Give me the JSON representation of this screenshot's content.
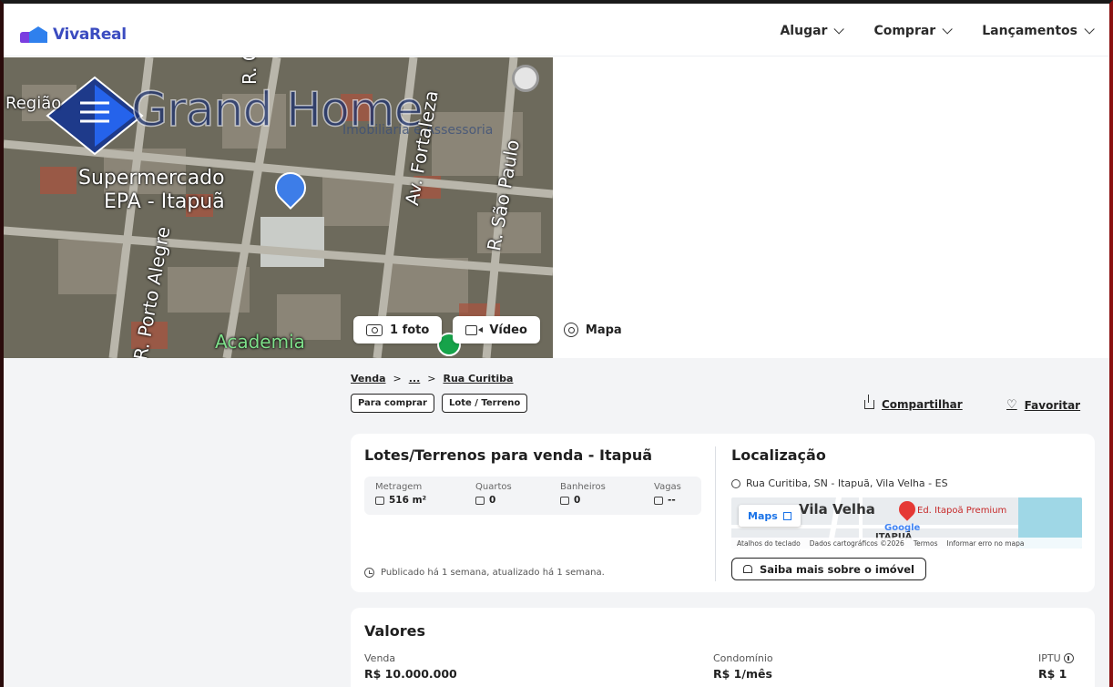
{
  "header": {
    "logo_text": "VivaReal",
    "nav": [
      {
        "label": "Alugar"
      },
      {
        "label": "Comprar"
      },
      {
        "label": "Lançamentos"
      }
    ]
  },
  "photo": {
    "watermark_brand": "Grand Home",
    "watermark_sub": "Imobiliária e Assessoria",
    "map_labels": [
      "Supermercado",
      "EPA - Itapuã",
      "R. Curitiba",
      "Av. Fortaleza",
      "R. São Paulo",
      "R. Porto Alegre",
      "Academia",
      "Região"
    ]
  },
  "media_buttons": {
    "photo_label": "1 foto",
    "video_label": "Vídeo",
    "map_label": "Mapa"
  },
  "breadcrumb": {
    "first": "Venda",
    "middle": "...",
    "last": "Rua Curitiba",
    "separator": ">"
  },
  "tags": [
    "Para comprar",
    "Lote / Terreno"
  ],
  "actions": {
    "share": "Compartilhar",
    "favorite": "Favoritar"
  },
  "listing": {
    "title": "Lotes/Terrenos para venda - Itapuã",
    "stats": [
      {
        "label": "Metragem",
        "value": "516 m²",
        "icon": "ruler-icon"
      },
      {
        "label": "Quartos",
        "value": "0",
        "icon": "bed-icon"
      },
      {
        "label": "Banheiros",
        "value": "0",
        "icon": "shower-icon"
      },
      {
        "label": "Vagas",
        "value": "--",
        "icon": "car-icon"
      }
    ],
    "published": "Publicado há 1 semana, atualizado há 1 semana."
  },
  "location": {
    "title": "Localização",
    "address": "Rua Curitiba, SN - Itapuã, Vila Velha - ES",
    "map": {
      "maps_button": "Maps",
      "city": "Vila Velha",
      "poi": "Ed. Itapoã Premium",
      "google": "Google",
      "district": "ITAPUÃ",
      "footer": [
        "Atalhos do teclado",
        "Dados cartográficos ©2026",
        "Termos",
        "Informar erro no mapa"
      ]
    },
    "more_button": "Saiba mais sobre o imóvel"
  },
  "values": {
    "title": "Valores",
    "items": [
      {
        "label": "Venda",
        "amount": "R$ 10.000.000"
      },
      {
        "label": "Condomínio",
        "amount": "R$ 1/mês"
      },
      {
        "label": "IPTU",
        "amount": "R$ 1"
      }
    ]
  },
  "colors": {
    "brand": "#3b4cc0",
    "background_gray": "#f3f4f6",
    "maps_link": "#1a73e8"
  }
}
